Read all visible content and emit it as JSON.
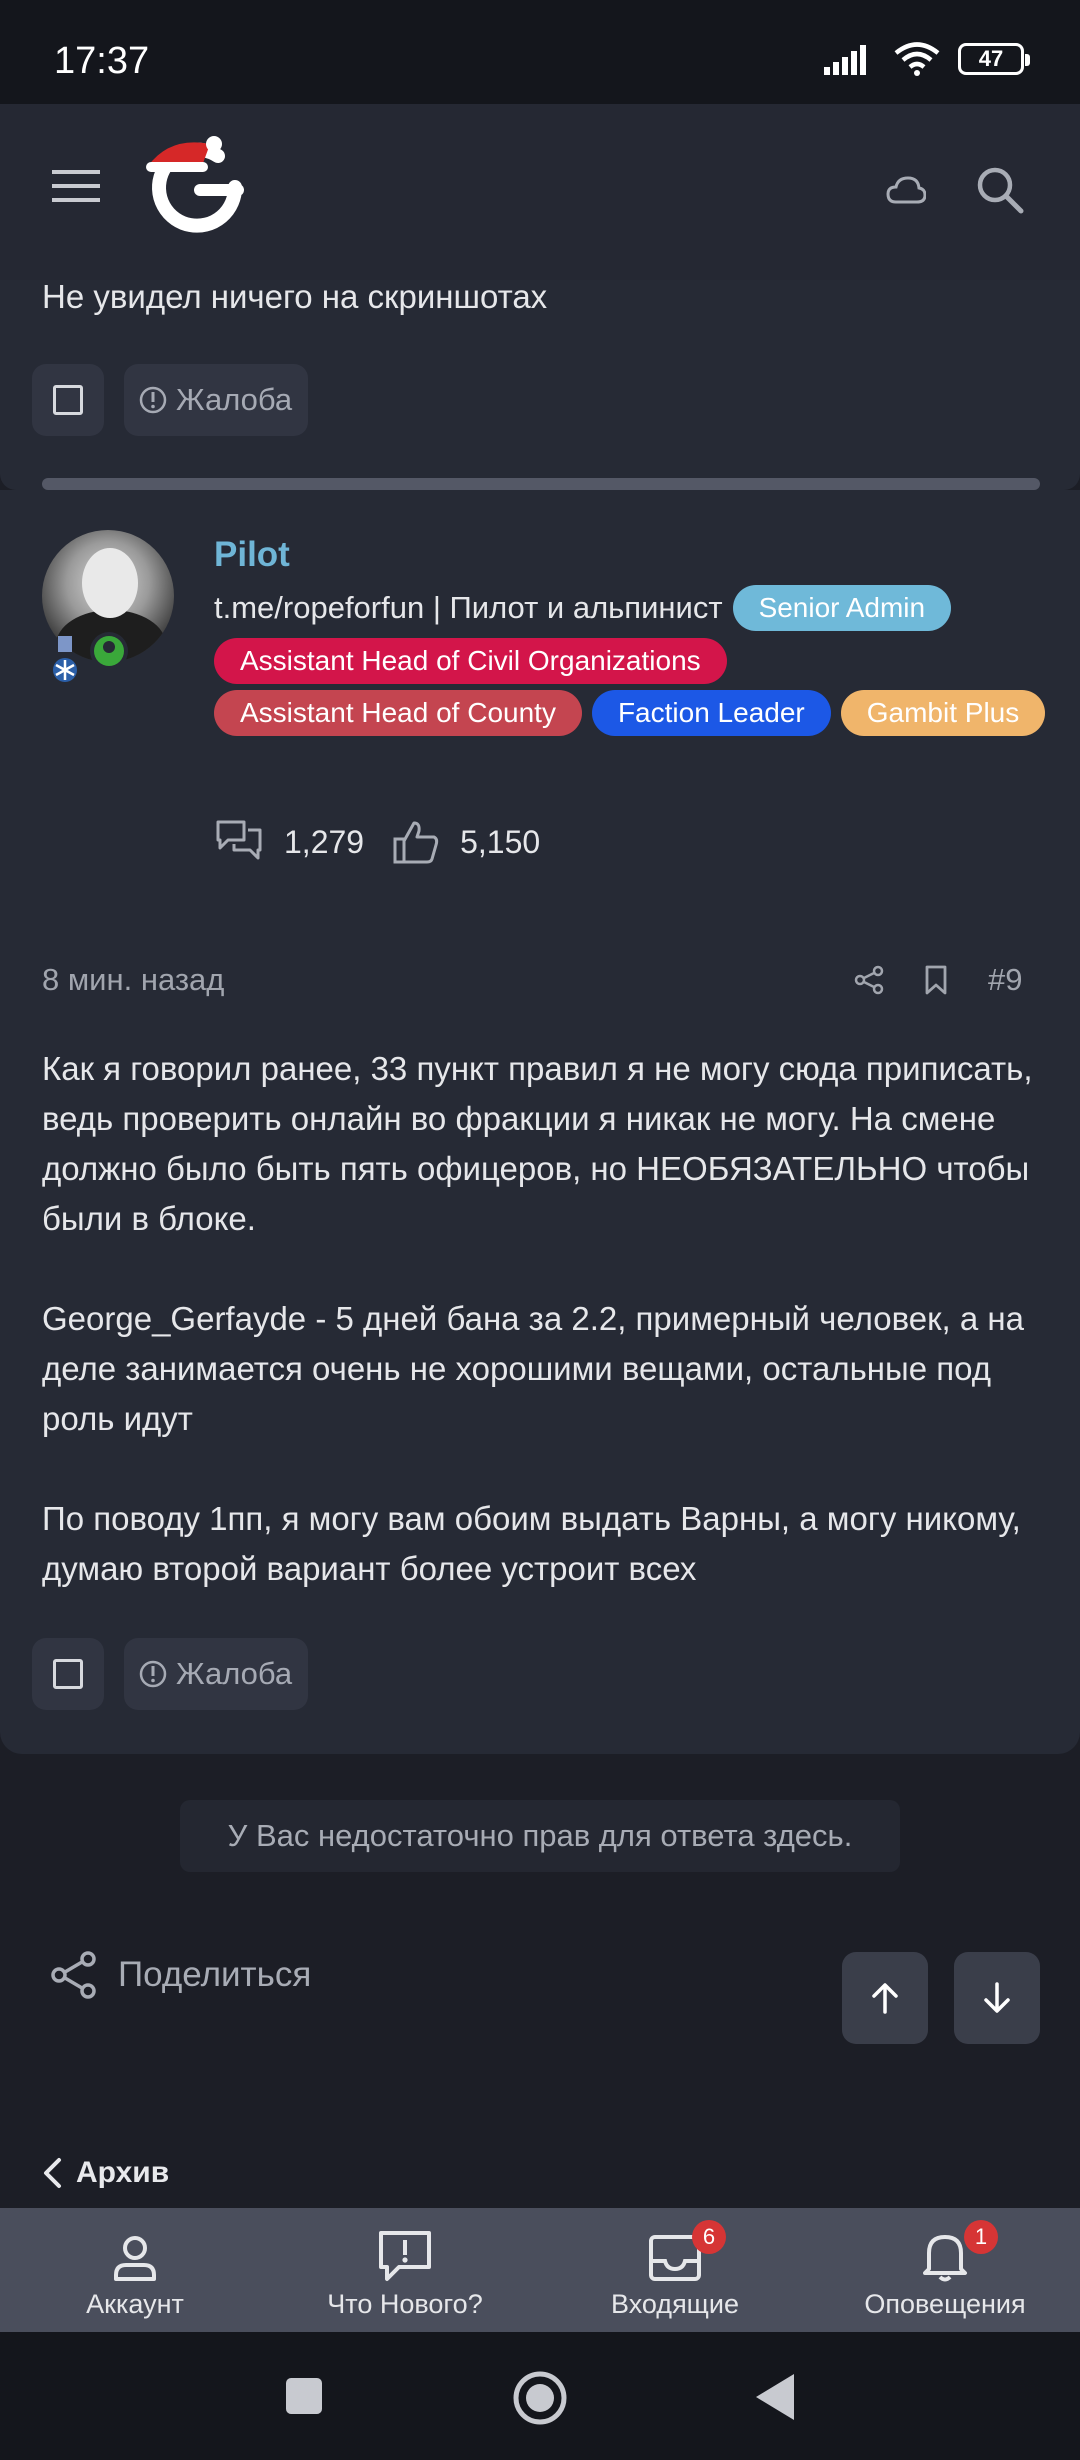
{
  "status_bar": {
    "time": "17:37",
    "battery": "47"
  },
  "previous_post": {
    "text": "Не увидел ничего на скриншотах",
    "report_label": "Жалоба"
  },
  "post": {
    "username": "Pilot",
    "user_title": "t.me/ropeforfun | Пилот и альпинист",
    "badges": [
      {
        "label": "Senior Admin",
        "color": "#6fb9d9"
      },
      {
        "label": "Assistant Head of Civil Organizations",
        "color": "#d3154a"
      },
      {
        "label": "Assistant Head of County",
        "color": "#c44550"
      },
      {
        "label": "Faction Leader",
        "color": "#1c58e6"
      },
      {
        "label": "Gambit Plus",
        "color": "#f0b56b"
      }
    ],
    "messages_count": "1,279",
    "likes_count": "5,150",
    "time": "8 мин. назад",
    "number": "#9",
    "paragraphs": [
      "Как я говорил ранее, 33 пункт правил я не могу сюда приписать, ведь проверить онлайн во фракции я никак не могу. На смене должно было быть пять офицеров, но НЕОБЯЗАТЕЛЬНО чтобы были в блоке.",
      "George_Gerfayde - 5 дней бана за 2.2, примерный человек, а на деле занимается очень не хорошими вещами, остальные под роль идут",
      "По поводу 1пп, я могу вам обоим выдать Варны, а могу никому, думаю второй вариант более устроит всех"
    ],
    "report_label": "Жалоба"
  },
  "no_permission": "У Вас недостаточно прав для ответа здесь.",
  "share_label": "Поделиться",
  "archive_label": "Архив",
  "bottom_nav": {
    "account": "Аккаунт",
    "whats_new": "Что Нового?",
    "inbox": "Входящие",
    "inbox_count": "6",
    "alerts": "Оповещения",
    "alerts_count": "1"
  }
}
